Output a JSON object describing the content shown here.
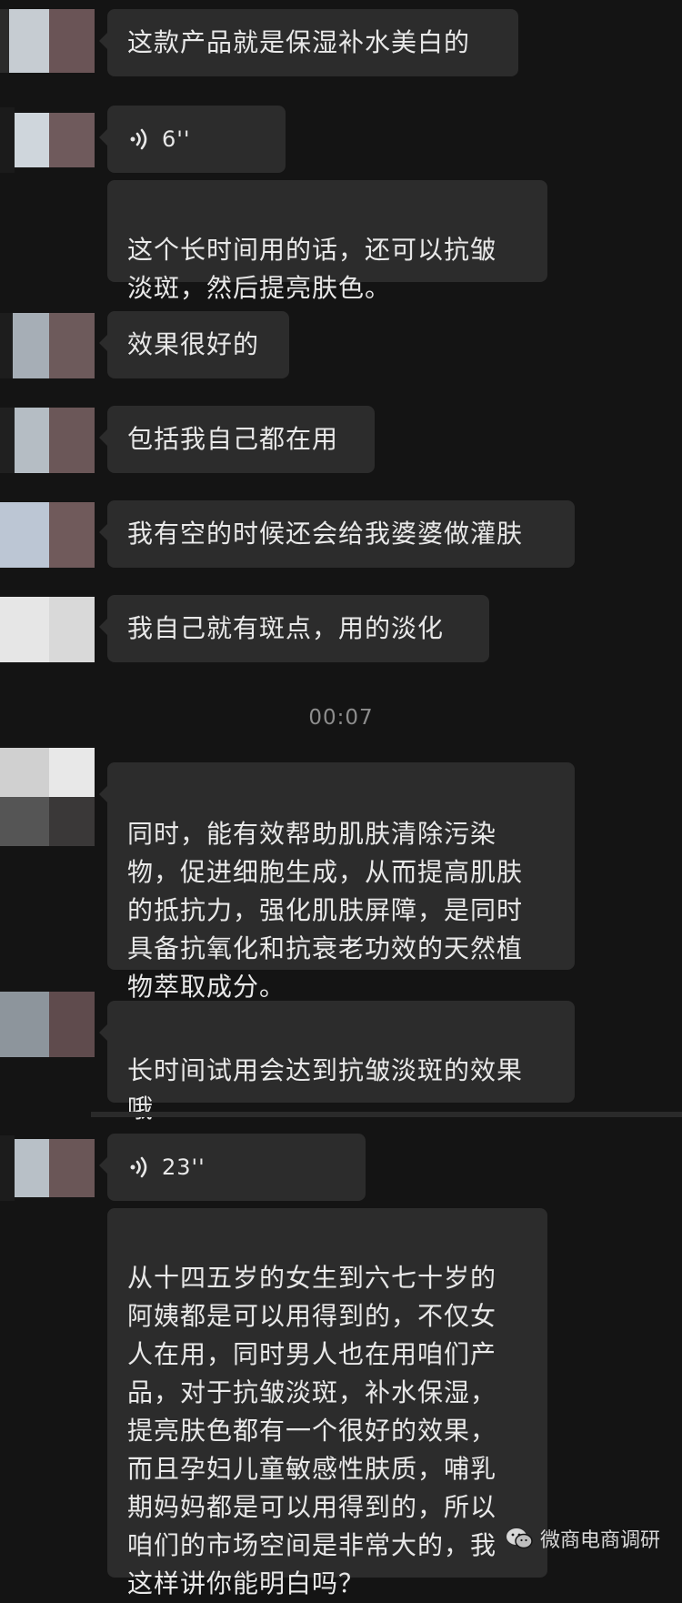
{
  "messages": [
    {
      "type": "text",
      "text": "这款产品就是保湿补水美白的"
    },
    {
      "type": "voice",
      "duration": "6''"
    },
    {
      "type": "text",
      "text": "这个长时间用的话，还可以抗皱\n淡斑，然后提亮肤色。"
    },
    {
      "type": "text",
      "text": "效果很好的"
    },
    {
      "type": "text",
      "text": "包括我自己都在用"
    },
    {
      "type": "text",
      "text": "我有空的时候还会给我婆婆做灌肤"
    },
    {
      "type": "text",
      "text": "我自己就有斑点，用的淡化"
    },
    {
      "type": "text",
      "text": "同时，能有效帮助肌肤清除污染\n物，促进细胞生成，从而提高肌肤\n的抵抗力，强化肌肤屏障，是同时\n具备抗氧化和抗衰老功效的天然植\n物萃取成分。"
    },
    {
      "type": "text",
      "text": "长时间试用会达到抗皱淡斑的效果\n哦"
    },
    {
      "type": "voice",
      "duration": "23''"
    },
    {
      "type": "text",
      "text": "从十四五岁的女生到六七十岁的\n阿姨都是可以用得到的，不仅女\n人在用，同时男人也在用咱们产\n品，对于抗皱淡斑，补水保湿，\n提亮肤色都有一个很好的效果，\n而且孕妇儿童敏感性肤质，哺乳\n期妈妈都是可以用得到的，所以\n咱们的市场空间是非常大的，我\n这样讲你能明白吗？"
    }
  ],
  "timestamp": "00:07",
  "watermark": {
    "text": "微商电商调研",
    "icon": "wechat-official-account-icon"
  },
  "colors": {
    "background": "#141414",
    "bubble": "#2c2c2c",
    "text": "#e8e8e8",
    "timestamp": "#8d8d8d"
  }
}
